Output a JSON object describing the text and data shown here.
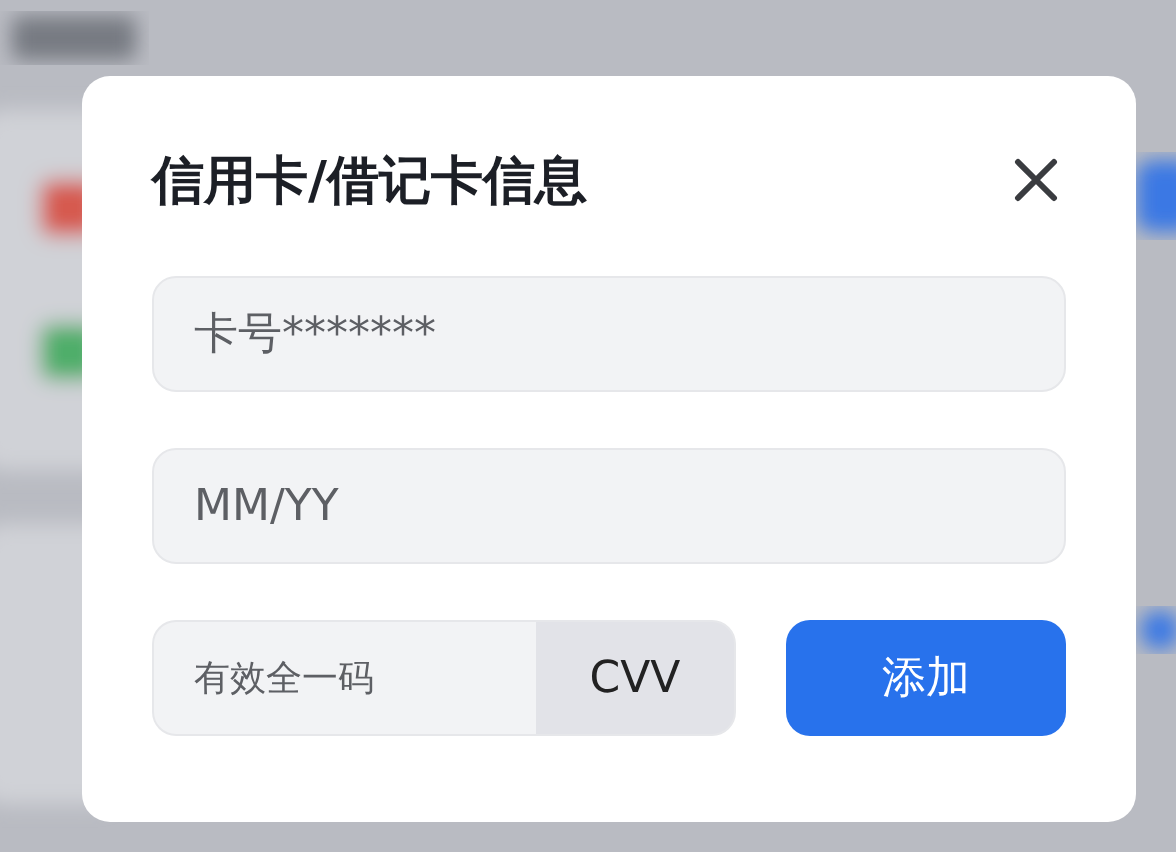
{
  "dialog": {
    "title": "信用卡/借记卡信息",
    "card_number": {
      "placeholder": "卡号*******"
    },
    "expiry": {
      "placeholder": "MM/YY"
    },
    "security_code": {
      "placeholder": "有效全一码",
      "suffix": "CVV"
    },
    "buttons": [
      {
        "label": "添加",
        "kind": "primary"
      }
    ]
  }
}
